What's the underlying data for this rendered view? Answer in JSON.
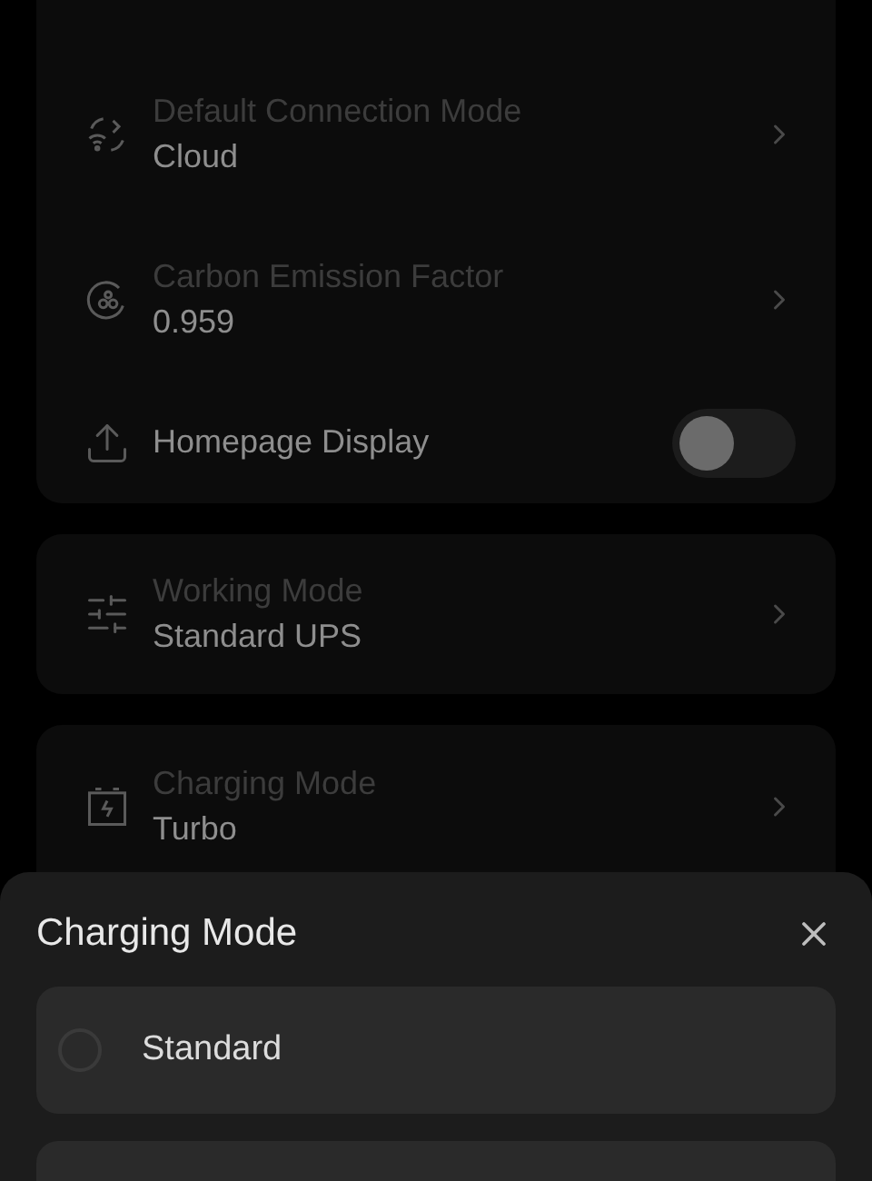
{
  "settings_group": [
    {
      "kind": "link",
      "label": "Default Connection Mode",
      "value": "Cloud"
    },
    {
      "kind": "link",
      "label": "Carbon Emission Factor",
      "value": "0.959"
    },
    {
      "kind": "toggle",
      "label": "Homepage Display",
      "on": false
    }
  ],
  "working_mode": {
    "label": "Working Mode",
    "value": "Standard UPS"
  },
  "charging_mode": {
    "label": "Charging Mode",
    "value": "Turbo"
  },
  "sheet": {
    "title": "Charging Mode",
    "options": [
      {
        "label": "Standard",
        "selected": false
      }
    ]
  }
}
